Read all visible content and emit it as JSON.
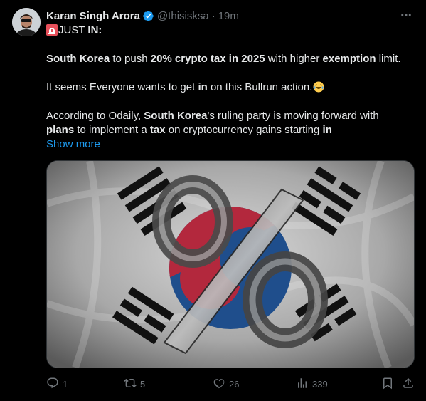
{
  "author": {
    "name": "Karan Singh Arora",
    "handle": "@thisisksa",
    "separator": "·",
    "time": "19m"
  },
  "tweet": {
    "line1": {
      "lead": "JUST ",
      "strong": "IN:"
    },
    "para1": {
      "s1": "South Korea",
      "t1": " to push ",
      "s2": "20% crypto tax in 2025",
      "t2": " with higher ",
      "s3": "exemption",
      "t3": " limit."
    },
    "para2": {
      "t1": "It seems Everyone wants to get ",
      "s1": "in",
      "t2": " on this Bullrun action."
    },
    "para3": {
      "t1": "According to Odaily, ",
      "s1": "South Korea",
      "t2": "'s ruling party is moving forward with",
      "s2": "plans",
      "t3": " to implement a ",
      "s3": "tax",
      "t4": " on cryptocurrency gains starting ",
      "s4": "in"
    },
    "show_more": "Show more"
  },
  "actions": {
    "replies": "1",
    "reposts": "5",
    "likes": "26",
    "views": "339"
  },
  "icons": [
    "siren-icon",
    "laughing-emoji-icon",
    "verified-badge-icon",
    "more-icon",
    "reply-icon",
    "repost-icon",
    "like-icon",
    "views-icon",
    "bookmark-icon",
    "share-icon"
  ],
  "colors": {
    "accent": "#1d9bf0",
    "text": "#e7e9ea",
    "muted": "#71767b",
    "background": "#000000",
    "flag_red": "#b3283d",
    "flag_blue": "#1f4e8c"
  }
}
